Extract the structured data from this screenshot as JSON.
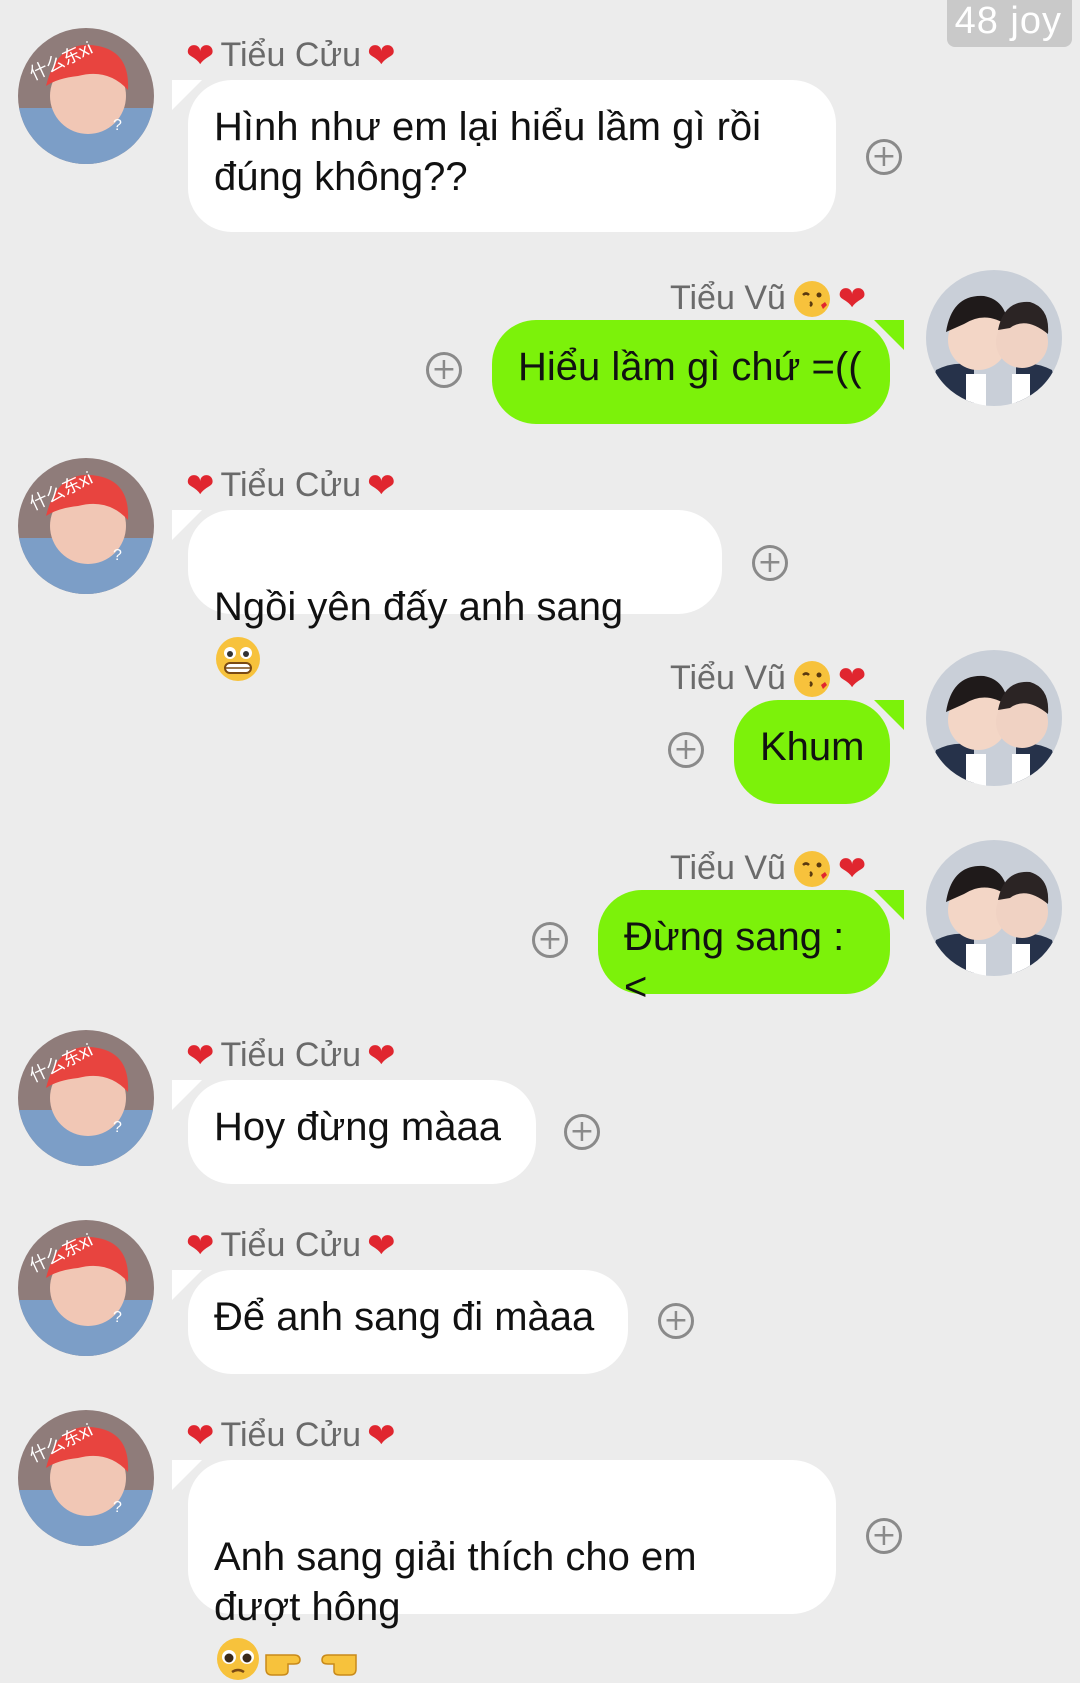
{
  "watermark": "48 joy",
  "contacts": {
    "left": {
      "name": "Tiểu Cửu",
      "prefix_icon": "heart-icon",
      "suffix_icon": "heart-icon",
      "avatar_text": "什么东xi"
    },
    "right": {
      "name": "Tiểu Vũ",
      "suffix_icons": [
        "wink-kiss-emoji",
        "heart-icon"
      ]
    }
  },
  "messages": [
    {
      "side": "left",
      "sender": "Tiểu Cửu",
      "text": "Hình như em lại hiểu lầm gì rồi\nđúng không??"
    },
    {
      "side": "right",
      "sender": "Tiểu Vũ",
      "text": "Hiểu lầm gì chứ =(("
    },
    {
      "side": "left",
      "sender": "Tiểu Cửu",
      "text": "Ngồi yên đấy anh sang",
      "emoji": "grimace-emoji"
    },
    {
      "side": "right",
      "sender": "Tiểu Vũ",
      "text": "Khum"
    },
    {
      "side": "right",
      "sender": "Tiểu Vũ",
      "text": "Đừng sang :<"
    },
    {
      "side": "left",
      "sender": "Tiểu Cửu",
      "text": "Hoy đừng màaa"
    },
    {
      "side": "left",
      "sender": "Tiểu Cửu",
      "text": "Để anh sang đi màaa"
    },
    {
      "side": "left",
      "sender": "Tiểu Cửu",
      "text": "Anh sang giải thích cho em\nđượt hông",
      "emoji": "pleading-pointing-emoji"
    }
  ],
  "colors": {
    "background": "#ececec",
    "left_bubble": "#ffffff",
    "right_bubble": "#7cf20a",
    "heart": "#e0262f"
  }
}
